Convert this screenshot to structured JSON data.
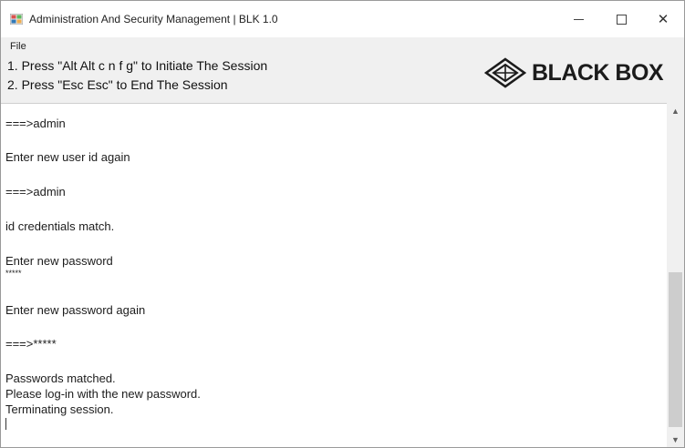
{
  "window": {
    "title": "Administration And Security Management | BLK 1.0",
    "minimize_glyph": "",
    "close_glyph": "✕"
  },
  "menu": {
    "file": "File"
  },
  "instructions": {
    "line1": "1. Press \"Alt Alt c n f g\" to Initiate The Session",
    "line2": "2. Press \"Esc Esc\" to End The Session"
  },
  "logo": {
    "text": "BLACK BOX",
    "icon": "blackbox-diamond-logo"
  },
  "console": {
    "lines": [
      "===>admin",
      "Enter new user id again",
      "===>admin",
      "id credentials match.",
      "Enter new password",
      "*****",
      "Enter new password again",
      "===>*****",
      "Passwords matched.",
      "Please log-in with the new password.",
      "Terminating session."
    ]
  },
  "scrollbar": {
    "up_arrow": "▲",
    "down_arrow": "▼"
  },
  "colors": {
    "header_bg": "#f0f0f0",
    "scroll_thumb": "#cdcdcd",
    "logo_text": "#1b1b1b"
  }
}
